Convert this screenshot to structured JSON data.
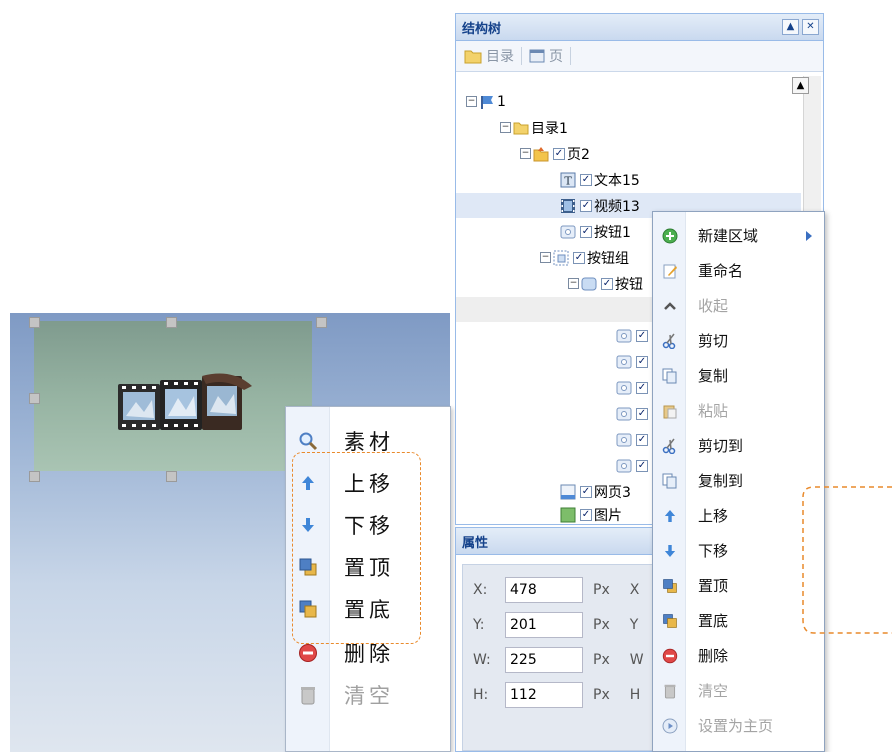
{
  "tree_panel": {
    "title": "结构树",
    "toolbar": {
      "catalog": "目录",
      "page": "页"
    },
    "nodes": {
      "root": "1",
      "dir1": "目录1",
      "page2": "页2",
      "text15": "文本15",
      "video": "视频13",
      "btn1": "按钮1",
      "btngroup": "按钮组",
      "btnsub": "按钮",
      "web": "网页3",
      "img": "图片"
    }
  },
  "properties": {
    "title": "属性",
    "x": {
      "label": "X:",
      "value": "478",
      "unit": "Px",
      "extra": "X"
    },
    "y": {
      "label": "Y:",
      "value": "201",
      "unit": "Px",
      "extra": "Y"
    },
    "w": {
      "label": "W:",
      "value": "225",
      "unit": "Px",
      "extra": "W"
    },
    "h": {
      "label": "H:",
      "value": "112",
      "unit": "Px",
      "extra": "H"
    }
  },
  "canvas_menu": {
    "items": [
      {
        "label": "素材",
        "icon": "magnifier-icon",
        "enabled": true
      },
      {
        "label": "上移",
        "icon": "arrow-up-icon",
        "enabled": true
      },
      {
        "label": "下移",
        "icon": "arrow-down-icon",
        "enabled": true
      },
      {
        "label": "置顶",
        "icon": "bring-to-front-icon",
        "enabled": true
      },
      {
        "label": "置底",
        "icon": "send-to-back-icon",
        "enabled": true
      },
      {
        "label": "删除",
        "icon": "delete-icon",
        "enabled": true
      },
      {
        "label": "清空",
        "icon": "trash-can-icon",
        "enabled": false
      }
    ]
  },
  "tree_menu": {
    "items": [
      {
        "label": "新建区域",
        "icon": "add-circle-icon",
        "enabled": true,
        "submenu": true
      },
      {
        "label": "重命名",
        "icon": "rename-icon",
        "enabled": true
      },
      {
        "label": "收起",
        "icon": "collapse-icon",
        "enabled": false
      },
      {
        "label": "剪切",
        "icon": "scissors-icon",
        "enabled": true
      },
      {
        "label": "复制",
        "icon": "copy-icon",
        "enabled": true
      },
      {
        "label": "粘贴",
        "icon": "paste-icon",
        "enabled": false
      },
      {
        "label": "剪切到",
        "icon": "scissors-icon",
        "enabled": true
      },
      {
        "label": "复制到",
        "icon": "copy-icon",
        "enabled": true
      },
      {
        "label": "上移",
        "icon": "arrow-up-icon",
        "enabled": true
      },
      {
        "label": "下移",
        "icon": "arrow-down-icon",
        "enabled": true
      },
      {
        "label": "置顶",
        "icon": "bring-to-front-icon",
        "enabled": true
      },
      {
        "label": "置底",
        "icon": "send-to-back-icon",
        "enabled": true
      },
      {
        "label": "删除",
        "icon": "delete-icon",
        "enabled": true
      },
      {
        "label": "清空",
        "icon": "trash-can-icon",
        "enabled": false
      },
      {
        "label": "设置为主页",
        "icon": "home-play-icon",
        "enabled": false
      }
    ]
  },
  "colors": {
    "highlight_dash": "#e98a2c",
    "panel_border": "#99bbe8",
    "header_text": "#15428b"
  }
}
